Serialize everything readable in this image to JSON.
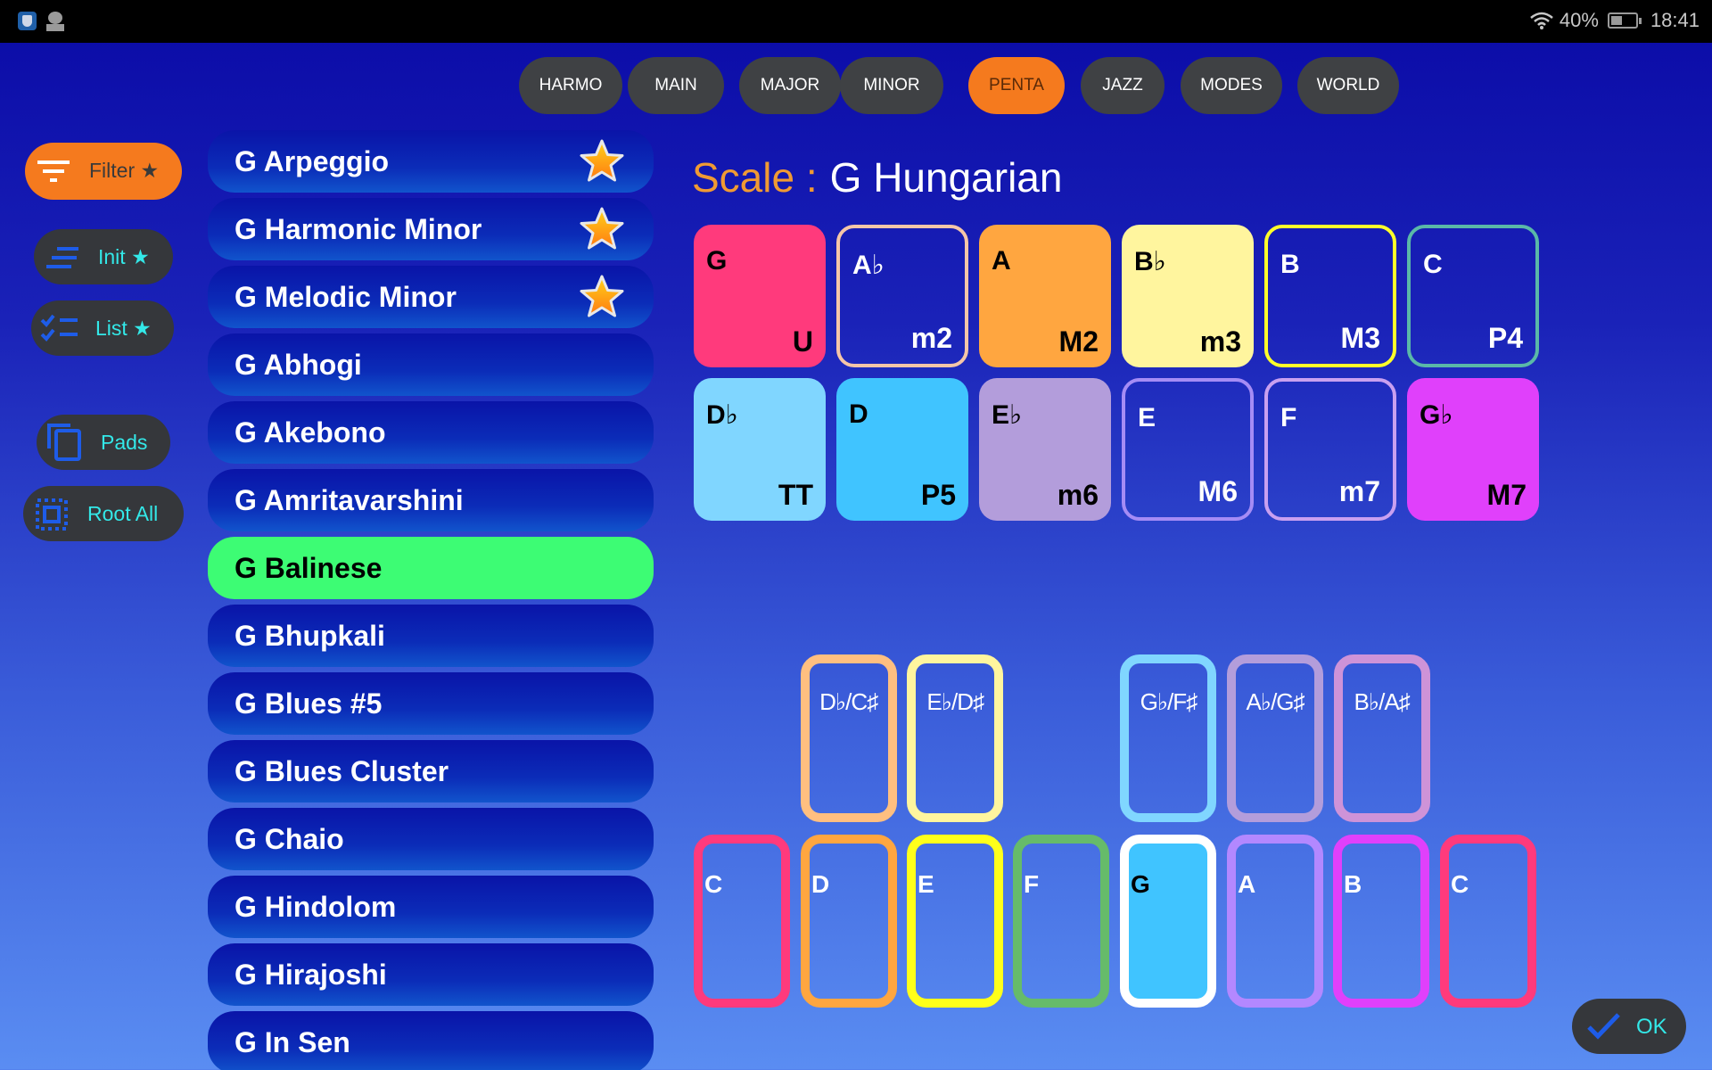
{
  "status_bar": {
    "battery_percent": "40%",
    "battery_level": 0.4,
    "time": "18:41"
  },
  "tabs": [
    {
      "label": "HARMO",
      "active": false
    },
    {
      "label": "MAIN",
      "active": false
    },
    {
      "label": "MAJOR",
      "active": false
    },
    {
      "label": "MINOR",
      "active": false
    },
    {
      "label": "PENTA",
      "active": true
    },
    {
      "label": "JAZZ",
      "active": false
    },
    {
      "label": "MODES",
      "active": false
    },
    {
      "label": "WORLD",
      "active": false
    }
  ],
  "sidebar": {
    "filter": "Filter ★",
    "init": "Init ★",
    "list": "List ★",
    "pads": "Pads",
    "root_all": "Root All"
  },
  "scale_list": [
    {
      "name": "G Arpeggio",
      "favorite": true,
      "selected": false
    },
    {
      "name": "G Harmonic Minor",
      "favorite": true,
      "selected": false
    },
    {
      "name": "G Melodic Minor",
      "favorite": true,
      "selected": false
    },
    {
      "name": "G Abhogi",
      "favorite": false,
      "selected": false
    },
    {
      "name": "G Akebono",
      "favorite": false,
      "selected": false
    },
    {
      "name": "G Amritavarshini",
      "favorite": false,
      "selected": false
    },
    {
      "name": "G Balinese",
      "favorite": false,
      "selected": true
    },
    {
      "name": "G Bhupkali",
      "favorite": false,
      "selected": false
    },
    {
      "name": "G Blues #5",
      "favorite": false,
      "selected": false
    },
    {
      "name": "G Blues Cluster",
      "favorite": false,
      "selected": false
    },
    {
      "name": "G Chaio",
      "favorite": false,
      "selected": false
    },
    {
      "name": "G Hindolom",
      "favorite": false,
      "selected": false
    },
    {
      "name": "G Hirajoshi",
      "favorite": false,
      "selected": false
    },
    {
      "name": "G In Sen",
      "favorite": false,
      "selected": false
    }
  ],
  "scale": {
    "label": "Scale :",
    "value": "G Hungarian"
  },
  "pads": [
    {
      "note": "G",
      "interval": "U",
      "filled": true,
      "color": "#ff3a7c",
      "text": "#000"
    },
    {
      "note": "A♭",
      "interval": "m2",
      "filled": false,
      "color": "#f5c6a8",
      "text": "#fff"
    },
    {
      "note": "A",
      "interval": "M2",
      "filled": true,
      "color": "#ffa640",
      "text": "#000"
    },
    {
      "note": "B♭",
      "interval": "m3",
      "filled": true,
      "color": "#fff59e",
      "text": "#000"
    },
    {
      "note": "B",
      "interval": "M3",
      "filled": false,
      "color": "#ffff2a",
      "text": "#fff"
    },
    {
      "note": "C",
      "interval": "P4",
      "filled": false,
      "color": "#5ab8a8",
      "text": "#fff"
    },
    {
      "note": "D♭",
      "interval": "TT",
      "filled": true,
      "color": "#80d6ff",
      "text": "#000"
    },
    {
      "note": "D",
      "interval": "P5",
      "filled": true,
      "color": "#40c4ff",
      "text": "#000"
    },
    {
      "note": "E♭",
      "interval": "m6",
      "filled": true,
      "color": "#b39ddb",
      "text": "#000"
    },
    {
      "note": "E",
      "interval": "M6",
      "filled": false,
      "color": "#a58cf5",
      "text": "#fff"
    },
    {
      "note": "F",
      "interval": "m7",
      "filled": false,
      "color": "#c9a0f0",
      "text": "#fff"
    },
    {
      "note": "G♭",
      "interval": "M7",
      "filled": true,
      "color": "#e040fb",
      "text": "#000"
    }
  ],
  "keyboard": {
    "black_keys": [
      {
        "label": "D♭/C♯",
        "color": "#ffbf80",
        "slot": 1
      },
      {
        "label": "E♭/D♯",
        "color": "#fff59e",
        "slot": 2
      },
      {
        "label": "G♭/F♯",
        "color": "#80d6ff",
        "slot": 4
      },
      {
        "label": "A♭/G♯",
        "color": "#b39ddb",
        "slot": 5
      },
      {
        "label": "B♭/A♯",
        "color": "#ce93d8",
        "slot": 6
      }
    ],
    "white_keys": [
      {
        "label": "C",
        "color": "#ff3a7c",
        "active": false
      },
      {
        "label": "D",
        "color": "#ffa640",
        "active": false
      },
      {
        "label": "E",
        "color": "#ffff1a",
        "active": false
      },
      {
        "label": "F",
        "color": "#66bb6a",
        "active": false
      },
      {
        "label": "G",
        "color": "#ffffff",
        "active": true,
        "fill": "#40c4ff"
      },
      {
        "label": "A",
        "color": "#b388ff",
        "active": false
      },
      {
        "label": "B",
        "color": "#e040fb",
        "active": false
      },
      {
        "label": "C",
        "color": "#ff3a7c",
        "active": false
      }
    ]
  },
  "ok_button": "OK"
}
